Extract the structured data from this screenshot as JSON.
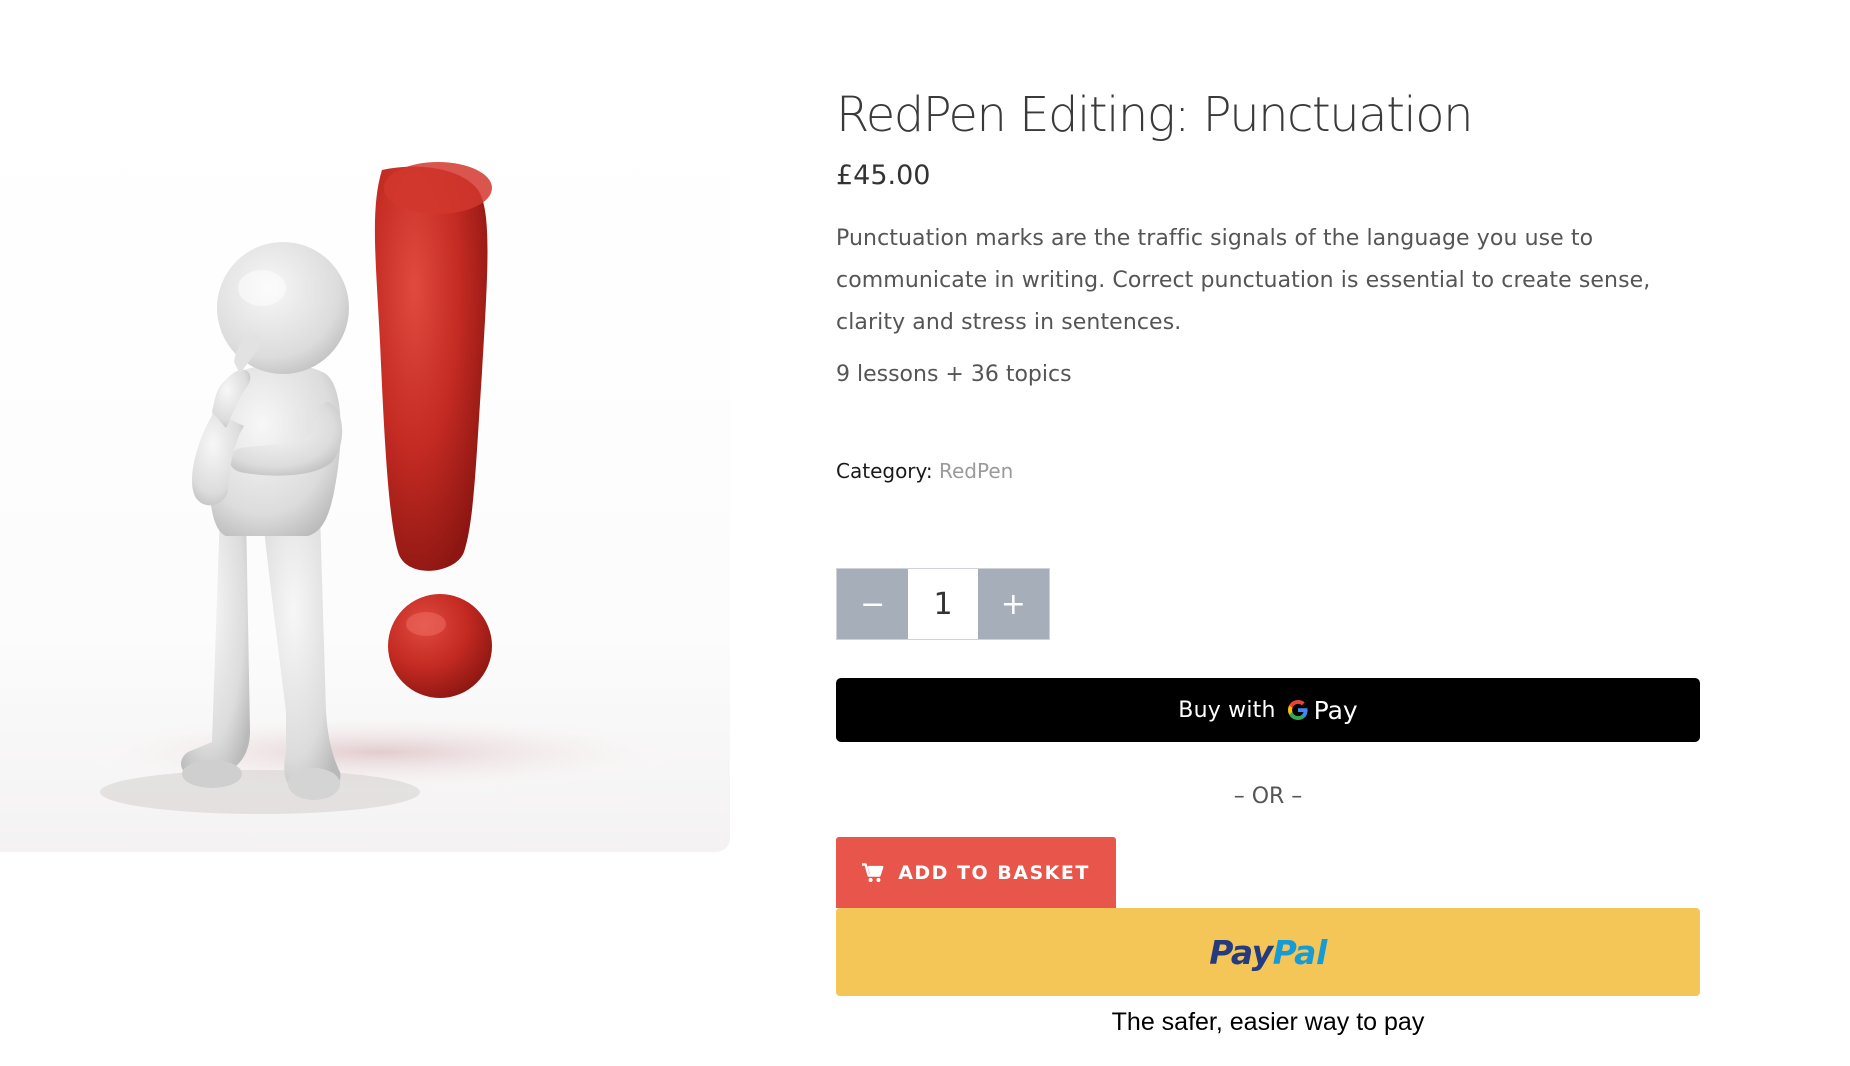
{
  "product": {
    "title": "RedPen Editing: Punctuation",
    "price": "£45.00",
    "description": "Punctuation marks are the traffic signals of the language you use to communicate in writing. Correct punctuation is essential to create sense, clarity and stress in sentences.",
    "lesson_count": "9 lessons + 36 topics",
    "category_label": "Category:",
    "category_value": "RedPen"
  },
  "quantity": {
    "decrement_label": "−",
    "value": "1",
    "increment_label": "+"
  },
  "google_pay": {
    "label": "Buy with",
    "logo_letter": "G",
    "logo_word": "Pay"
  },
  "separator": "– OR –",
  "add_to_basket": {
    "label": "ADD TO BASKET",
    "icon": "cart-icon"
  },
  "paypal": {
    "logo_part1": "Pay",
    "logo_part2": "Pal",
    "tagline": "The safer, easier way to pay"
  },
  "colors": {
    "add_to_basket_bg": "#e8554b",
    "paypal_bg": "#f4c557",
    "gpay_bg": "#000000",
    "qty_button_bg": "#a5aeb9",
    "exclamation_red": "#c8302a"
  }
}
